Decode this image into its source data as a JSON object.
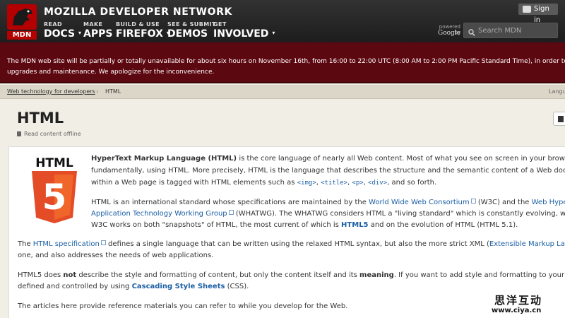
{
  "header": {
    "site_title": "MOZILLA DEVELOPER NETWORK",
    "logo_text": "MDN",
    "nav": [
      {
        "small": "READ",
        "big": "DOCS",
        "caret": "▾"
      },
      {
        "small": "MAKE",
        "big": "APPS",
        "caret": ""
      },
      {
        "small": "BUILD & USE",
        "big": "FIREFOX",
        "caret": "▾"
      },
      {
        "small": "SEE & SUBMIT",
        "big": "DEMOS",
        "caret": ""
      },
      {
        "small": "GET",
        "big": "INVOLVED",
        "caret": "▾"
      }
    ],
    "signin_label": "Sign in",
    "powered_by": "powered by",
    "google": "Google",
    "search_placeholder": "Search MDN"
  },
  "banner": {
    "line1": "The MDN web site will be partially or totally unavailable for about six hours on November 16th, from 16:00 to 22:00 UTC (8:00 AM to 2:00 PM Pacific Standard Time), in order to perfor",
    "line2": "upgrades and maintenance. We apologize for the inconvenience."
  },
  "breadcrumb": {
    "parent": "Web technology for developers",
    "separator": "›",
    "current": "HTML",
    "language": "Langu"
  },
  "page": {
    "title": "HTML",
    "offline": "Read content offline"
  },
  "logo_html5": {
    "top": "HTML",
    "number": "5"
  },
  "content": {
    "p1_bold": "HyperText Markup Language (HTML)",
    "p1_a": " is the core language of nearly all Web content. Most of what you see on screen in your browser i",
    "p1_b": "fundamentally, using HTML. More precisely, HTML is the language that describes the structure and the semantic content of a Web docu",
    "p1_c": "within a Web page is tagged with HTML elements such as ",
    "tag_img": "<img>",
    "tag_title": "<title>",
    "tag_p": "<p>",
    "tag_div": "<div>",
    "p1_c_end": ", and so forth.",
    "comma": ", ",
    "p2_a": "HTML is an international standard whose specifications are maintained by the ",
    "p2_w3c_link": "World Wide Web Consortium",
    "p2_a2": " (W3C) and the ",
    "p2_whatwg_link": "Web Hyper",
    "p2_b_link": "Application Technology Working Group",
    "p2_b": " (WHATWG). The WHATWG considers HTML a \"living standard\" which is constantly evolving, w",
    "p2_c1": "W3C works on both \"snapshots\" of HTML, the most current of which is ",
    "p2_html5": "HTML5",
    "p2_c2": " and on the evolution of HTML (HTML 5.1).",
    "p3_a": "The ",
    "p3_spec_link": "HTML specification",
    "p3_a2": " defines a single language that can be written using the relaxed HTML syntax, but also the more strict XML (",
    "p3_xml_link": "Extensible Markup La",
    "p3_b": "one, and also addresses the needs of web applications.",
    "p4_a": "HTML5 does ",
    "p4_not": "not",
    "p4_a2": " describe the style and formatting of content, but only the content itself and its ",
    "p4_meaning": "meaning",
    "p4_a3": ". If you want to add style and formatting to your w",
    "p4_b": "defined and controlled by using ",
    "p4_css_link": "Cascading Style Sheets",
    "p4_b2": " (CSS).",
    "p5": "The articles here provide reference materials you can refer to while you develop for the Web."
  },
  "watermark": {
    "cn": "思洋互动",
    "url": "www.ciya.cn"
  }
}
